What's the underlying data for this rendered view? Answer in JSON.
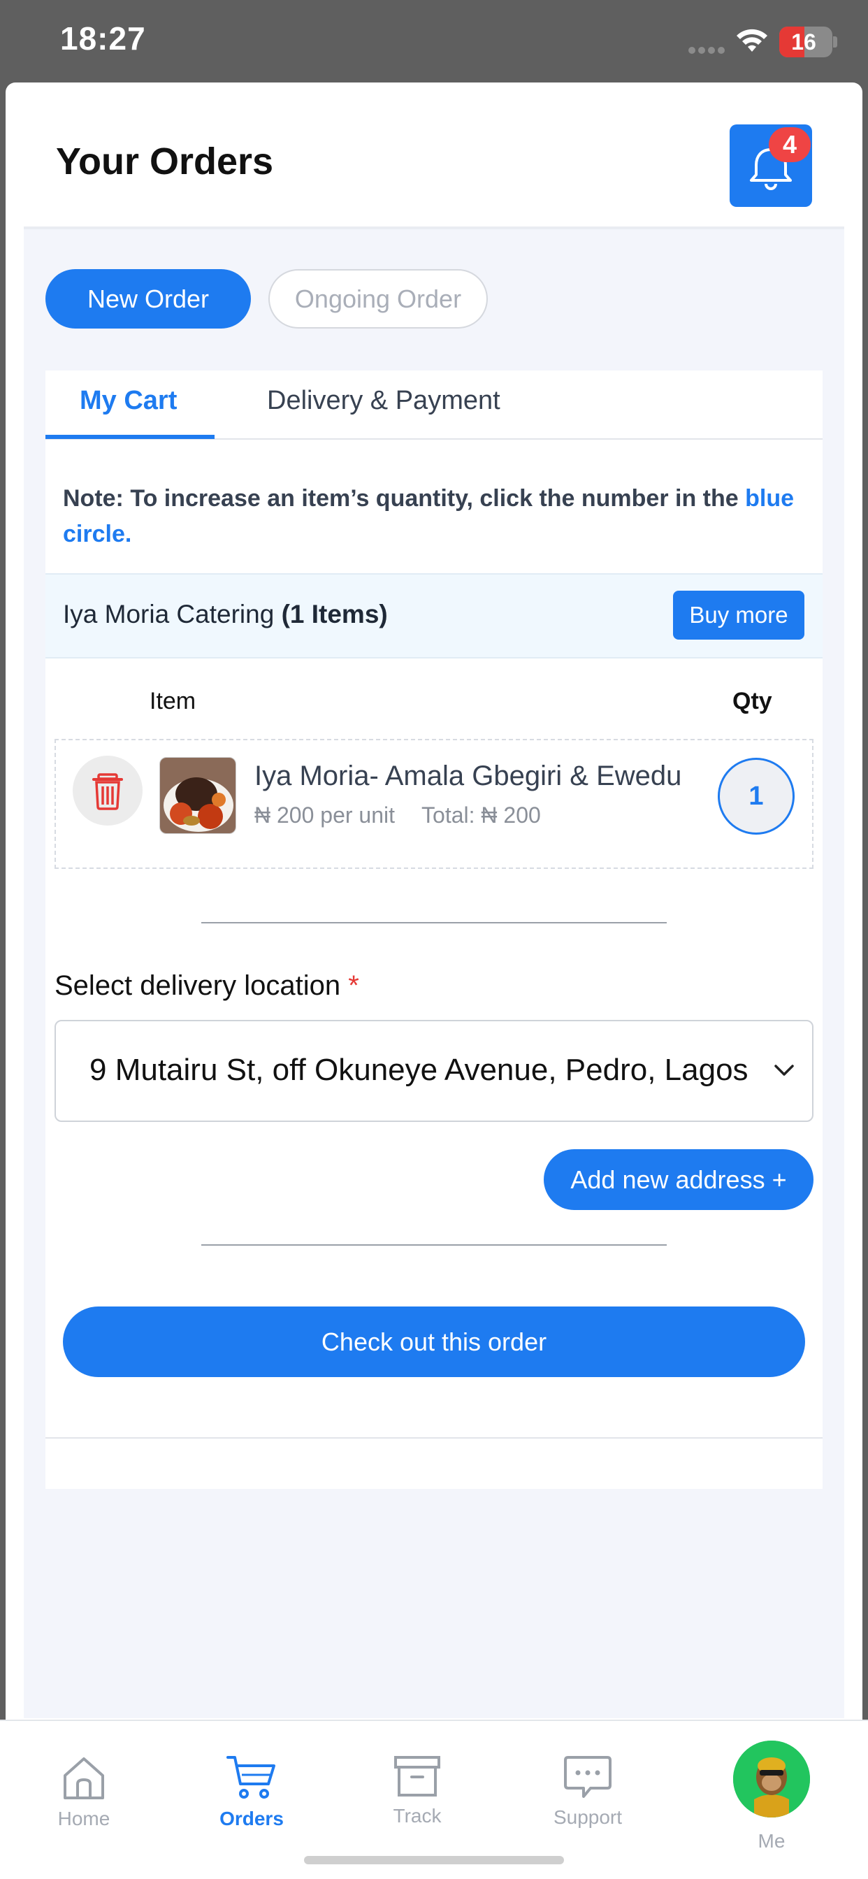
{
  "status_bar": {
    "time": "18:27",
    "battery": "16"
  },
  "header": {
    "title": "Your Orders",
    "notification_count": "4"
  },
  "segments": {
    "new_order": "New Order",
    "ongoing_order": "Ongoing Order"
  },
  "tabs": {
    "my_cart": "My Cart",
    "delivery_payment": "Delivery & Payment"
  },
  "note": {
    "text": "Note: To increase an item’s quantity, click the number in the ",
    "highlight": "blue circle."
  },
  "vendor": {
    "name": "Iya Moria Catering ",
    "count": "(1 Items)",
    "buy_more": "Buy more"
  },
  "columns": {
    "item": "Item",
    "qty": "Qty"
  },
  "cart_item": {
    "name": "Iya Moria- Amala Gbegiri & Ewedu",
    "unit_price": "₦ 200 per unit",
    "total": "Total: ₦ 200",
    "qty": "1"
  },
  "delivery": {
    "label": "Select delivery location ",
    "required_mark": "*",
    "selected": "9 Mutairu St, off Okuneye Avenue, Pedro, Lagos",
    "add_address": "Add new address +"
  },
  "checkout": {
    "label": "Check out this order"
  },
  "bottom_nav": {
    "home": "Home",
    "orders": "Orders",
    "track": "Track",
    "support": "Support",
    "me": "Me",
    "active": "orders"
  },
  "colors": {
    "accent": "#1e7bf0",
    "danger": "#e53935",
    "badge": "#ef4444"
  }
}
